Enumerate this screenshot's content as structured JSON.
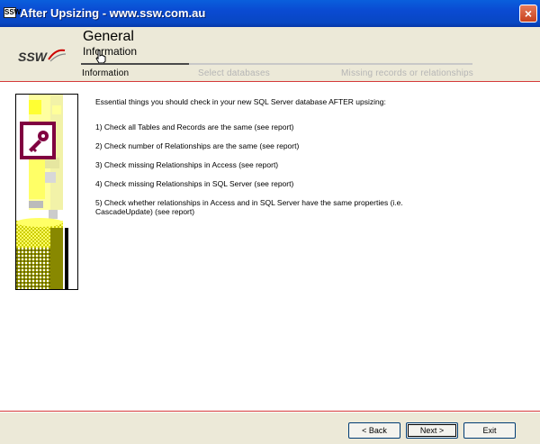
{
  "window": {
    "title": "After Upsizing - www.ssw.com.au",
    "app_icon": "SSW",
    "close_label": "×"
  },
  "header": {
    "logo_text": "SSW",
    "title": "General",
    "subtitle": "Information"
  },
  "steps": [
    {
      "label": "Information",
      "active": true
    },
    {
      "label": "Select databases",
      "active": false
    },
    {
      "label": "Missing records or relationships",
      "active": false
    }
  ],
  "main": {
    "intro": "Essential things you should check in your new SQL Server database AFTER upsizing:",
    "items": [
      "1) Check all Tables and Records are the same (see report)",
      "2) Check number of Relationships are the same  (see report)",
      "3) Check missing Relationships in Access (see report)",
      "4) Check missing Relationships in SQL Server (see report)",
      "5) Check whether relationships in Access and in SQL Server have the same properties (i.e. CascadeUpdate) (see report)"
    ]
  },
  "buttons": {
    "back": "< Back",
    "next": "Next >",
    "exit": "Exit"
  },
  "colors": {
    "titlebar": "#0a4ad2",
    "accent_red": "#d53a3a",
    "access_maroon": "#800040",
    "chrome": "#ece9d8"
  }
}
